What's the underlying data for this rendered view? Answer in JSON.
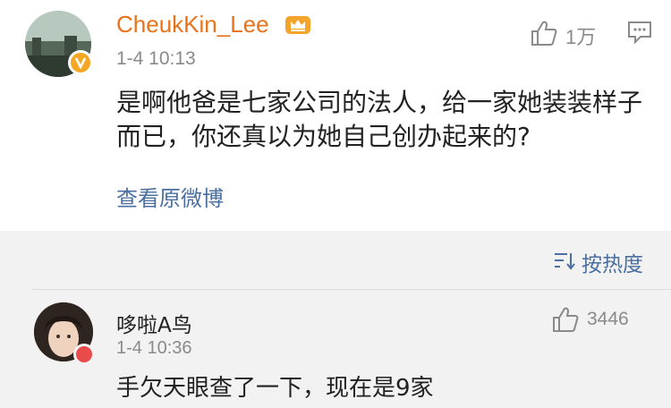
{
  "main_comment": {
    "username": "CheukKin_Lee",
    "timestamp": "1-4 10:13",
    "like_count": "1万",
    "text": "是啊他爸是七家公司的法人，给一家她装装样子而已，你还真以为她自己创办起来的?",
    "view_original_label": "查看原微博",
    "icons": {
      "crown": "crown-icon",
      "verified": "verified-badge-icon",
      "like": "like-icon",
      "reply": "reply-icon"
    },
    "accent_colors": {
      "username": "#e8731a",
      "link": "#4a6fa0",
      "badge": "#f5a623"
    }
  },
  "sort": {
    "label": "按热度"
  },
  "reply_comment": {
    "username": "哆啦A鸟",
    "timestamp": "1-4 10:36",
    "like_count": "3446",
    "text": "手欠天眼查了一下，现在是9家"
  }
}
